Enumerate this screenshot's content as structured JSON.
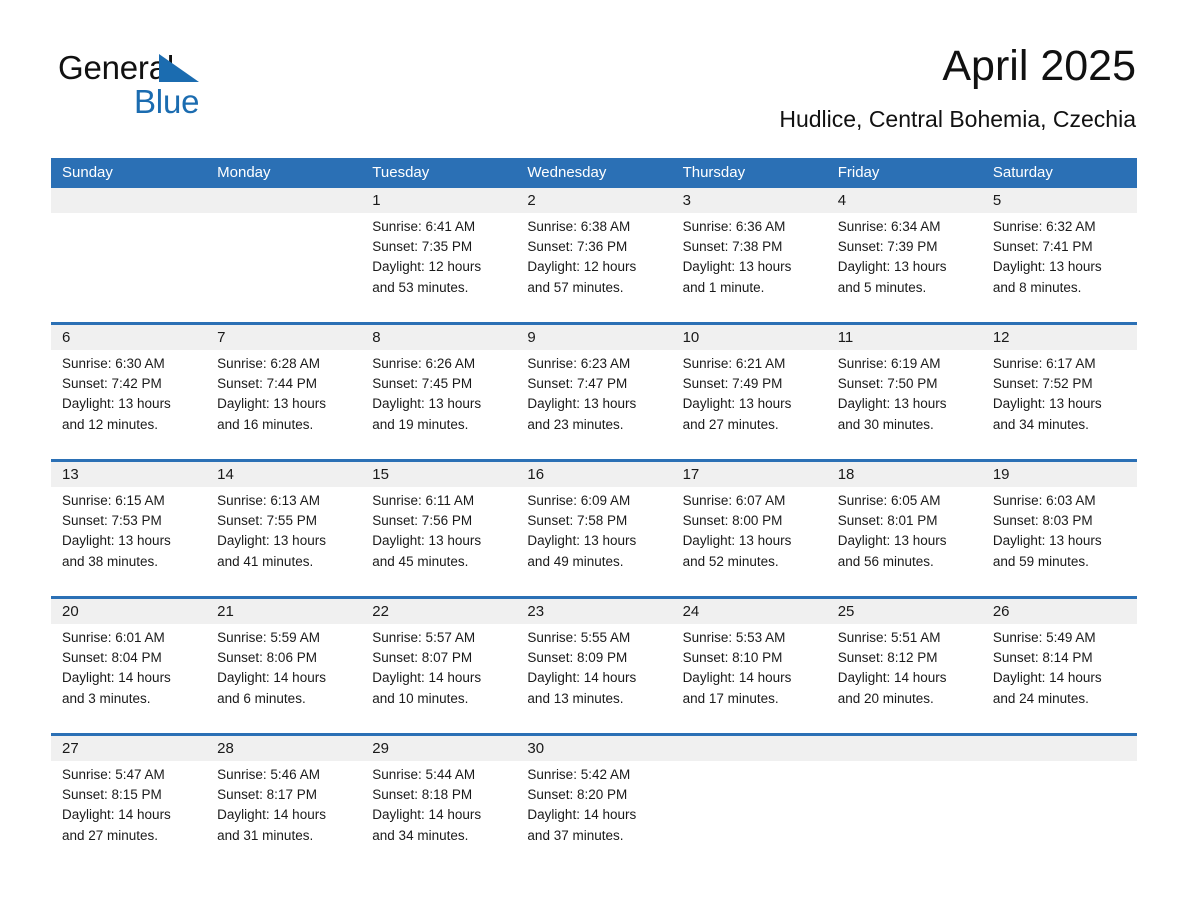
{
  "logo": {
    "word1": "General",
    "word2": "Blue",
    "triangle_color": "#1b6cb0"
  },
  "header": {
    "title": "April 2025",
    "subtitle": "Hudlice, Central Bohemia, Czechia"
  },
  "theme": {
    "header_blue": "#2b70b5",
    "row_divider_blue": "#2b70b5",
    "daynum_band": "#f0f0f0",
    "text": "#1a1a1a"
  },
  "weekdays": [
    "Sunday",
    "Monday",
    "Tuesday",
    "Wednesday",
    "Thursday",
    "Friday",
    "Saturday"
  ],
  "weeks": [
    [
      {
        "num": "",
        "sunrise": "",
        "sunset": "",
        "daylight_a": "",
        "daylight_b": "",
        "empty": true
      },
      {
        "num": "",
        "sunrise": "",
        "sunset": "",
        "daylight_a": "",
        "daylight_b": "",
        "empty": true
      },
      {
        "num": "1",
        "sunrise": "Sunrise: 6:41 AM",
        "sunset": "Sunset: 7:35 PM",
        "daylight_a": "Daylight: 12 hours",
        "daylight_b": "and 53 minutes."
      },
      {
        "num": "2",
        "sunrise": "Sunrise: 6:38 AM",
        "sunset": "Sunset: 7:36 PM",
        "daylight_a": "Daylight: 12 hours",
        "daylight_b": "and 57 minutes."
      },
      {
        "num": "3",
        "sunrise": "Sunrise: 6:36 AM",
        "sunset": "Sunset: 7:38 PM",
        "daylight_a": "Daylight: 13 hours",
        "daylight_b": "and 1 minute."
      },
      {
        "num": "4",
        "sunrise": "Sunrise: 6:34 AM",
        "sunset": "Sunset: 7:39 PM",
        "daylight_a": "Daylight: 13 hours",
        "daylight_b": "and 5 minutes."
      },
      {
        "num": "5",
        "sunrise": "Sunrise: 6:32 AM",
        "sunset": "Sunset: 7:41 PM",
        "daylight_a": "Daylight: 13 hours",
        "daylight_b": "and 8 minutes."
      }
    ],
    [
      {
        "num": "6",
        "sunrise": "Sunrise: 6:30 AM",
        "sunset": "Sunset: 7:42 PM",
        "daylight_a": "Daylight: 13 hours",
        "daylight_b": "and 12 minutes."
      },
      {
        "num": "7",
        "sunrise": "Sunrise: 6:28 AM",
        "sunset": "Sunset: 7:44 PM",
        "daylight_a": "Daylight: 13 hours",
        "daylight_b": "and 16 minutes."
      },
      {
        "num": "8",
        "sunrise": "Sunrise: 6:26 AM",
        "sunset": "Sunset: 7:45 PM",
        "daylight_a": "Daylight: 13 hours",
        "daylight_b": "and 19 minutes."
      },
      {
        "num": "9",
        "sunrise": "Sunrise: 6:23 AM",
        "sunset": "Sunset: 7:47 PM",
        "daylight_a": "Daylight: 13 hours",
        "daylight_b": "and 23 minutes."
      },
      {
        "num": "10",
        "sunrise": "Sunrise: 6:21 AM",
        "sunset": "Sunset: 7:49 PM",
        "daylight_a": "Daylight: 13 hours",
        "daylight_b": "and 27 minutes."
      },
      {
        "num": "11",
        "sunrise": "Sunrise: 6:19 AM",
        "sunset": "Sunset: 7:50 PM",
        "daylight_a": "Daylight: 13 hours",
        "daylight_b": "and 30 minutes."
      },
      {
        "num": "12",
        "sunrise": "Sunrise: 6:17 AM",
        "sunset": "Sunset: 7:52 PM",
        "daylight_a": "Daylight: 13 hours",
        "daylight_b": "and 34 minutes."
      }
    ],
    [
      {
        "num": "13",
        "sunrise": "Sunrise: 6:15 AM",
        "sunset": "Sunset: 7:53 PM",
        "daylight_a": "Daylight: 13 hours",
        "daylight_b": "and 38 minutes."
      },
      {
        "num": "14",
        "sunrise": "Sunrise: 6:13 AM",
        "sunset": "Sunset: 7:55 PM",
        "daylight_a": "Daylight: 13 hours",
        "daylight_b": "and 41 minutes."
      },
      {
        "num": "15",
        "sunrise": "Sunrise: 6:11 AM",
        "sunset": "Sunset: 7:56 PM",
        "daylight_a": "Daylight: 13 hours",
        "daylight_b": "and 45 minutes."
      },
      {
        "num": "16",
        "sunrise": "Sunrise: 6:09 AM",
        "sunset": "Sunset: 7:58 PM",
        "daylight_a": "Daylight: 13 hours",
        "daylight_b": "and 49 minutes."
      },
      {
        "num": "17",
        "sunrise": "Sunrise: 6:07 AM",
        "sunset": "Sunset: 8:00 PM",
        "daylight_a": "Daylight: 13 hours",
        "daylight_b": "and 52 minutes."
      },
      {
        "num": "18",
        "sunrise": "Sunrise: 6:05 AM",
        "sunset": "Sunset: 8:01 PM",
        "daylight_a": "Daylight: 13 hours",
        "daylight_b": "and 56 minutes."
      },
      {
        "num": "19",
        "sunrise": "Sunrise: 6:03 AM",
        "sunset": "Sunset: 8:03 PM",
        "daylight_a": "Daylight: 13 hours",
        "daylight_b": "and 59 minutes."
      }
    ],
    [
      {
        "num": "20",
        "sunrise": "Sunrise: 6:01 AM",
        "sunset": "Sunset: 8:04 PM",
        "daylight_a": "Daylight: 14 hours",
        "daylight_b": "and 3 minutes."
      },
      {
        "num": "21",
        "sunrise": "Sunrise: 5:59 AM",
        "sunset": "Sunset: 8:06 PM",
        "daylight_a": "Daylight: 14 hours",
        "daylight_b": "and 6 minutes."
      },
      {
        "num": "22",
        "sunrise": "Sunrise: 5:57 AM",
        "sunset": "Sunset: 8:07 PM",
        "daylight_a": "Daylight: 14 hours",
        "daylight_b": "and 10 minutes."
      },
      {
        "num": "23",
        "sunrise": "Sunrise: 5:55 AM",
        "sunset": "Sunset: 8:09 PM",
        "daylight_a": "Daylight: 14 hours",
        "daylight_b": "and 13 minutes."
      },
      {
        "num": "24",
        "sunrise": "Sunrise: 5:53 AM",
        "sunset": "Sunset: 8:10 PM",
        "daylight_a": "Daylight: 14 hours",
        "daylight_b": "and 17 minutes."
      },
      {
        "num": "25",
        "sunrise": "Sunrise: 5:51 AM",
        "sunset": "Sunset: 8:12 PM",
        "daylight_a": "Daylight: 14 hours",
        "daylight_b": "and 20 minutes."
      },
      {
        "num": "26",
        "sunrise": "Sunrise: 5:49 AM",
        "sunset": "Sunset: 8:14 PM",
        "daylight_a": "Daylight: 14 hours",
        "daylight_b": "and 24 minutes."
      }
    ],
    [
      {
        "num": "27",
        "sunrise": "Sunrise: 5:47 AM",
        "sunset": "Sunset: 8:15 PM",
        "daylight_a": "Daylight: 14 hours",
        "daylight_b": "and 27 minutes."
      },
      {
        "num": "28",
        "sunrise": "Sunrise: 5:46 AM",
        "sunset": "Sunset: 8:17 PM",
        "daylight_a": "Daylight: 14 hours",
        "daylight_b": "and 31 minutes."
      },
      {
        "num": "29",
        "sunrise": "Sunrise: 5:44 AM",
        "sunset": "Sunset: 8:18 PM",
        "daylight_a": "Daylight: 14 hours",
        "daylight_b": "and 34 minutes."
      },
      {
        "num": "30",
        "sunrise": "Sunrise: 5:42 AM",
        "sunset": "Sunset: 8:20 PM",
        "daylight_a": "Daylight: 14 hours",
        "daylight_b": "and 37 minutes."
      },
      {
        "num": "",
        "sunrise": "",
        "sunset": "",
        "daylight_a": "",
        "daylight_b": "",
        "empty": true
      },
      {
        "num": "",
        "sunrise": "",
        "sunset": "",
        "daylight_a": "",
        "daylight_b": "",
        "empty": true
      },
      {
        "num": "",
        "sunrise": "",
        "sunset": "",
        "daylight_a": "",
        "daylight_b": "",
        "empty": true
      }
    ]
  ]
}
